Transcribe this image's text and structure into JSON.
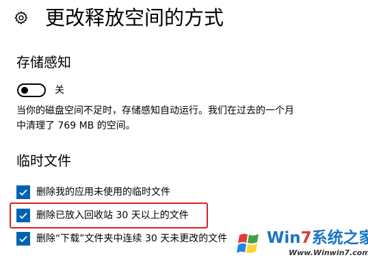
{
  "header": {
    "title": "更改释放空间的方式",
    "icon": "gear-icon"
  },
  "storage_sense": {
    "title": "存储感知",
    "toggle_state": "关",
    "toggle_on": false,
    "description_line1": "当你的磁盘空间不足时，存储感知自动运行。我们在过去的一个月",
    "description_line2": "中清理了 769 MB 的空间。"
  },
  "temp_files": {
    "title": "临时文件",
    "options": [
      {
        "label": "删除我的应用未使用的临时文件",
        "checked": true
      },
      {
        "label": "删除已放入回收站 30 天以上的文件",
        "checked": true
      },
      {
        "label": "删除“下载”文件夹中连续 30 天未更改的文件",
        "checked": true
      }
    ]
  },
  "watermark": {
    "brand": {
      "w": "W",
      "in": "in",
      "seven": "7",
      "rest": "系统之家"
    },
    "url": "Www.Winwin7.com"
  },
  "colors": {
    "accent": "#0063b1",
    "highlight": "#d61f1f",
    "brand_blue": "#1a73c8",
    "brand_red": "#e53935"
  }
}
